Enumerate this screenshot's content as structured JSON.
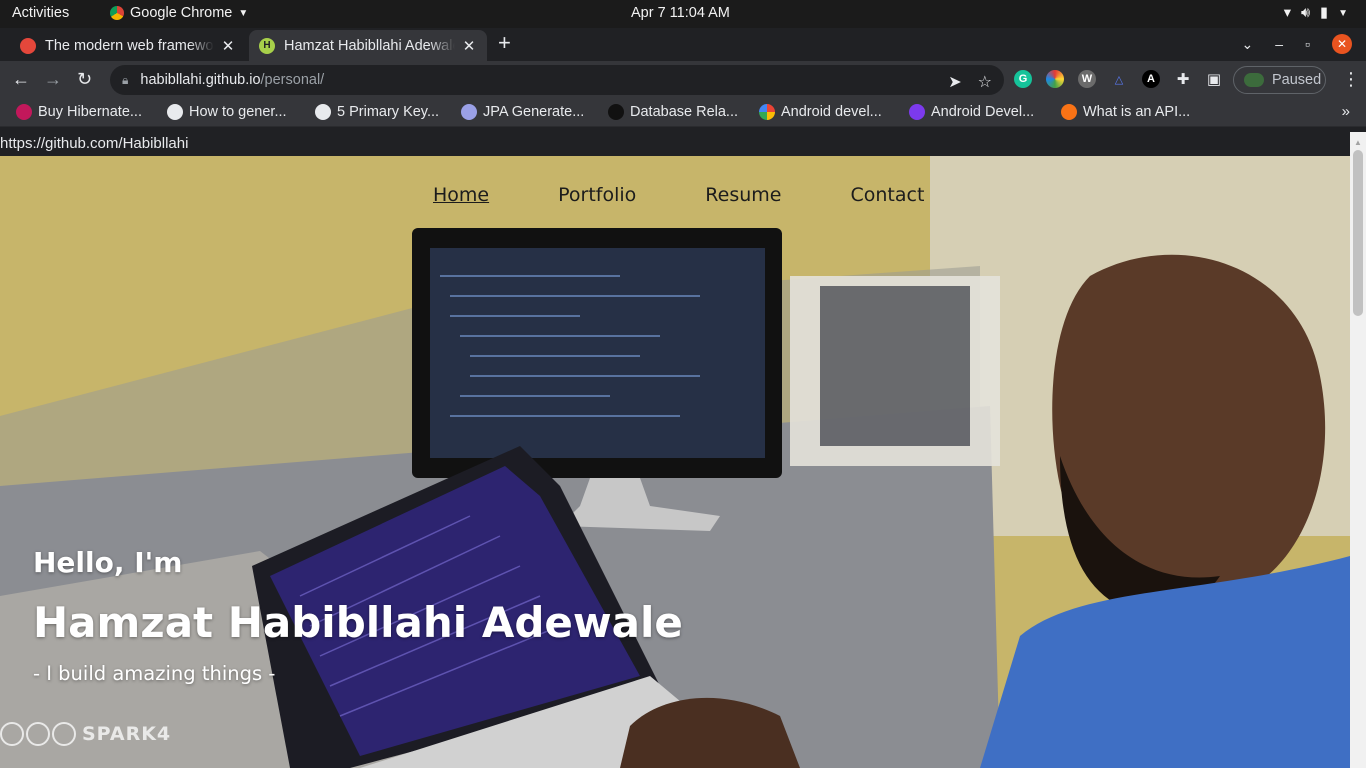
{
  "system_bar": {
    "activities": "Activities",
    "app_name": "Google Chrome",
    "clock": "Apr 7  11:04 AM"
  },
  "tabs": [
    {
      "title": "The modern web framework",
      "icon": "hardhat-favicon",
      "active": false
    },
    {
      "title": "Hamzat Habibllahi Adewale",
      "icon": "h-favicon",
      "active": true
    }
  ],
  "address_bar": {
    "host": "habibllahi.github.io",
    "path": "/personal/"
  },
  "profile": {
    "label": "Paused"
  },
  "bookmarks": [
    {
      "label": "Buy Hibernate...",
      "icon": "raspberry-icon",
      "color": "#c2185b"
    },
    {
      "label": "How to gener...",
      "icon": "globe-icon",
      "color": "#e8eaed"
    },
    {
      "label": "5 Primary Key...",
      "icon": "globe-icon",
      "color": "#e8eaed"
    },
    {
      "label": "JPA Generate...",
      "icon": "owl-icon",
      "color": "#9aa0e6"
    },
    {
      "label": "Database Rela...",
      "icon": "gear-icon",
      "color": "#111111"
    },
    {
      "label": "Android devel...",
      "icon": "google-icon",
      "color": "#4285f4"
    },
    {
      "label": "Android Devel...",
      "icon": "d-icon",
      "color": "#7c3aed"
    },
    {
      "label": "What is an API...",
      "icon": "mascot-icon",
      "color": "#f97316"
    }
  ],
  "status_url": "https://github.com/Habibllahi",
  "site": {
    "nav": [
      {
        "label": "Home",
        "active": true
      },
      {
        "label": "Portfolio",
        "active": false
      },
      {
        "label": "Resume",
        "active": false
      },
      {
        "label": "Contact",
        "active": false
      }
    ],
    "greeting": "Hello, I'm",
    "name": "Hamzat Habibllahi Adewale",
    "tagline": "- I build amazing things -",
    "watermark": "SPARK4"
  }
}
